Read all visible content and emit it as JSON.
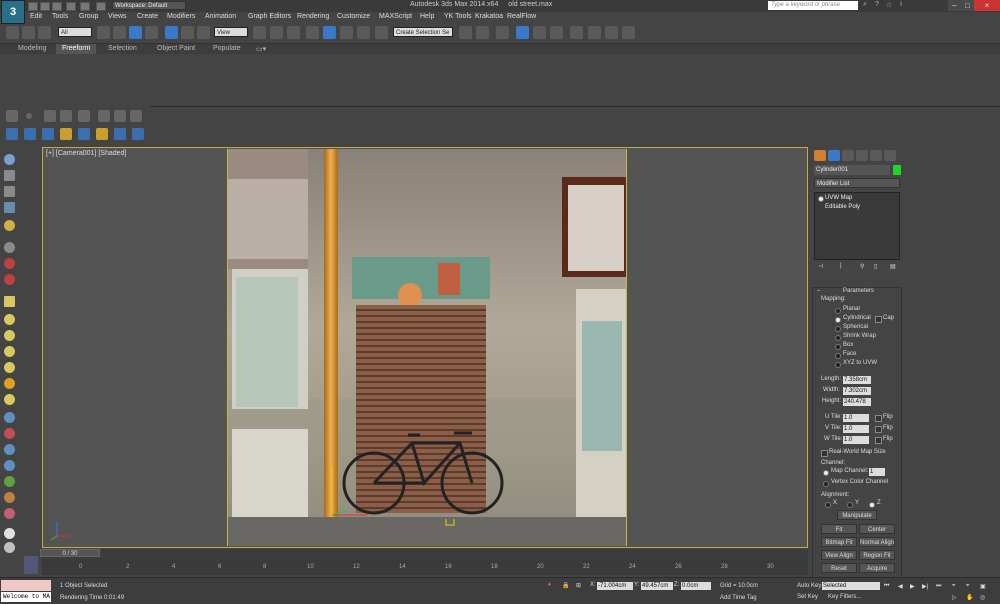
{
  "titlebar": {
    "app_title": "Autodesk 3ds Max 2014 x64",
    "file_name": "old street.max",
    "workspace": "Workspace: Default",
    "search_placeholder": "Type a keyword or phrase"
  },
  "menu": [
    "Edit",
    "Tools",
    "Group",
    "Views",
    "Create",
    "Modifiers",
    "Animation",
    "Graph Editors",
    "Rendering",
    "Customize",
    "MAXScript",
    "Help",
    "YK Tools",
    "Krakatoa",
    "RealFlow"
  ],
  "main_toolbar": {
    "selection_filter": "All",
    "ref_coord": "View",
    "named_selection": "Create Selection Se"
  },
  "ribbon": {
    "tabs": [
      "Modeling",
      "Freeform",
      "Selection",
      "Object Paint",
      "Populate"
    ],
    "active_tab": "Freeform"
  },
  "viewport": {
    "label": "[+] [Camera001] [Shaded]"
  },
  "command_panel": {
    "object_name": "Cylinder001",
    "object_color": "#1ed42a",
    "modifier_list": "Modifier List",
    "stack": [
      "UVW Map",
      "Editable Poly"
    ],
    "rollout_title": "Parameters",
    "mapping_label": "Mapping:",
    "mapping_options": [
      "Planar",
      "Cylindrical",
      "Spherical",
      "Shrink Wrap",
      "Box",
      "Face",
      "XYZ to UVW"
    ],
    "mapping_selected": "Cylindrical",
    "cap_label": "Cap",
    "length_label": "Length:",
    "length_value": "7.358cm",
    "width_label": "Width:",
    "width_value": "7.302cm",
    "height_label": "Height:",
    "height_value": "240.478",
    "u_tile_label": "U Tile:",
    "u_tile": "1.0",
    "v_tile_label": "V Tile:",
    "v_tile": "1.0",
    "w_tile_label": "W Tile:",
    "w_tile": "1.0",
    "flip_label": "Flip",
    "real_world": "Real-World Map Size",
    "channel_label": "Channel:",
    "map_channel_label": "Map Channel:",
    "map_channel_value": "1",
    "vertex_color": "Vertex Color Channel",
    "alignment_label": "Alignment:",
    "axes": [
      "X",
      "Y",
      "Z"
    ],
    "axis_selected": "Z",
    "manipulate": "Manipulate",
    "buttons": [
      [
        "Fit",
        "Center"
      ],
      [
        "Bitmap Fit",
        "Normal Align"
      ],
      [
        "View Align",
        "Region Fit"
      ],
      [
        "Reset",
        "Acquire"
      ]
    ]
  },
  "timeline": {
    "slider": "0 / 30",
    "ticks": [
      "0",
      "2",
      "4",
      "6",
      "8",
      "10",
      "12",
      "14",
      "16",
      "18",
      "20",
      "22",
      "24",
      "26",
      "28",
      "30"
    ]
  },
  "statusbar": {
    "maxscript": "Welcome to MA",
    "selection": "1 Object Selected",
    "rendering_time": "Rendering Time  0:01:49",
    "x_label": "X:",
    "x_value": "-71.004cm",
    "y_label": "Y:",
    "y_value": "49.457cm",
    "z_label": "Z:",
    "z_value": "0.0cm",
    "grid": "Grid = 10.0cm",
    "add_time_tag": "Add Time Tag",
    "auto_key": "Auto Key",
    "selected": "Selected",
    "set_key": "Set Key",
    "key_filters": "Key Filters..."
  }
}
